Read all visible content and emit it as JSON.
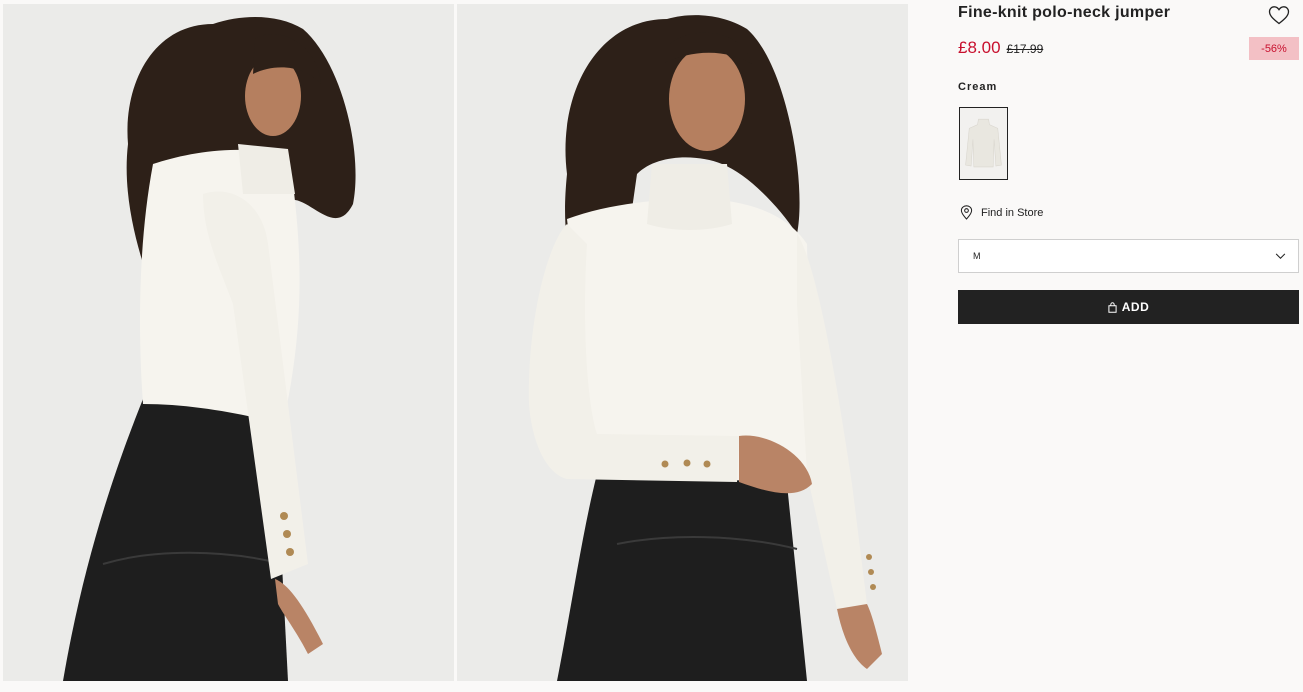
{
  "product": {
    "title": "Fine-knit polo-neck jumper",
    "price_now": "£8.00",
    "price_old": "£17.99",
    "discount": "-56%",
    "color_label": "Cream",
    "find_in_store": "Find in Store",
    "size_selected": "M",
    "add_label": "ADD"
  },
  "colors": {
    "accent_sale": "#c8102e",
    "discount_bg": "#f3c0c5",
    "button_bg": "#222222",
    "garment": "#f6f4ee",
    "skirt": "#1e1e1e",
    "hair": "#2d2018"
  },
  "icons": {
    "favorite": "heart-icon",
    "store": "location-pin-icon",
    "dropdown": "chevron-down-icon",
    "bag": "shopping-bag-icon"
  }
}
